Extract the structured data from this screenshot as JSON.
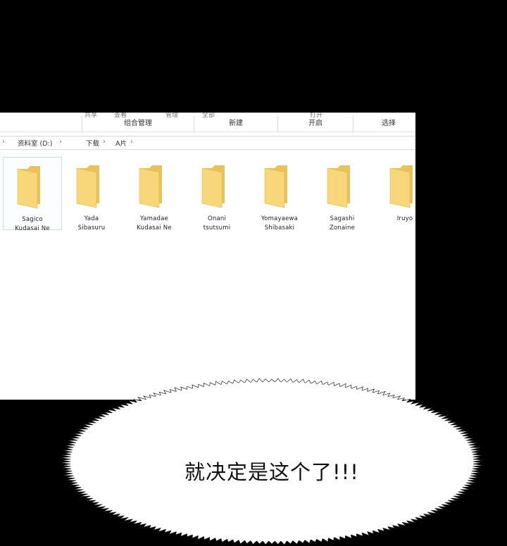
{
  "ribbon": {
    "cut_labels": [
      "共享",
      "查看",
      "管理",
      "全部",
      "打开"
    ],
    "groups": [
      "组合管理",
      "新建",
      "开启",
      "选择"
    ]
  },
  "address": {
    "drive": "资料室 (D:)",
    "folder1": "下载",
    "folder2": "A片",
    "separator": "›"
  },
  "folders": [
    {
      "line1": "Sagico",
      "line2": "Kudasai Ne"
    },
    {
      "line1": "Yada",
      "line2": "Sibasuru"
    },
    {
      "line1": "Yamadae",
      "line2": "Kudasai Ne"
    },
    {
      "line1": "Onani",
      "line2": "tsutsumi"
    },
    {
      "line1": "Yomayaewa",
      "line2": "Shibasaki"
    },
    {
      "line1": "Sagashi",
      "line2": "Zonaine"
    },
    {
      "line1": "Iruyo",
      "line2": ""
    }
  ],
  "dialogue": "就决定是这个了!!!",
  "colors": {
    "background": "#000000",
    "folder_front": "#f8d77a",
    "folder_back": "#e9c25a",
    "selection_border": "#bfe3f5"
  }
}
